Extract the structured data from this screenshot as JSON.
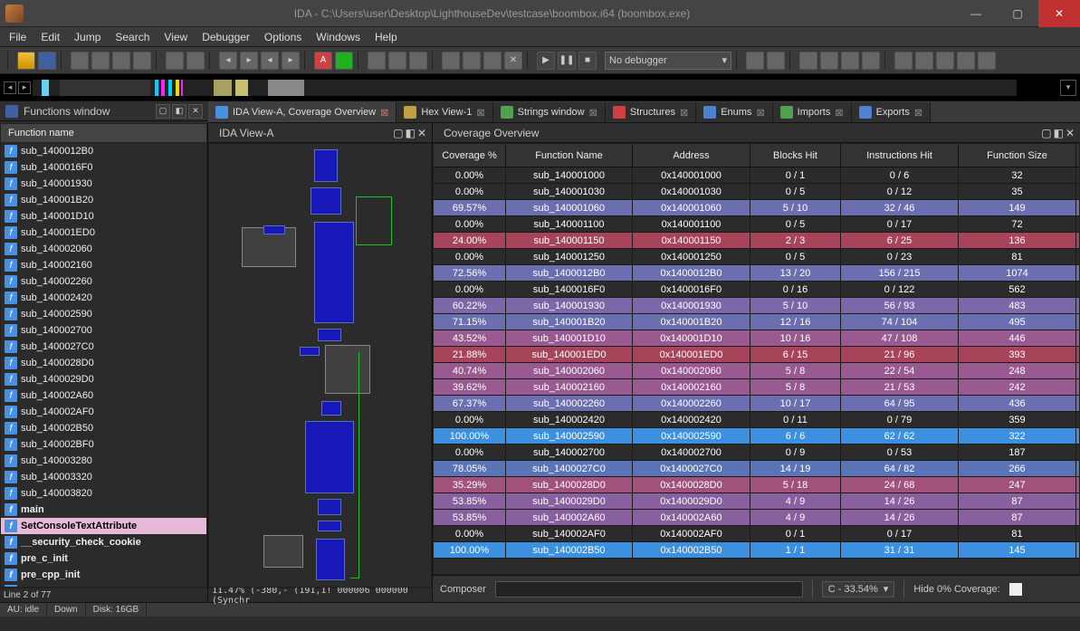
{
  "title": "IDA - C:\\Users\\user\\Desktop\\LighthouseDev\\testcase\\boombox.i64 (boombox.exe)",
  "menu": [
    "File",
    "Edit",
    "Jump",
    "Search",
    "View",
    "Debugger",
    "Options",
    "Windows",
    "Help"
  ],
  "debugger_combo": "No debugger",
  "functions_window": {
    "title": "Functions window",
    "header": "Function name",
    "status": "Line 2 of 77",
    "items": [
      {
        "name": "sub_1400012B0"
      },
      {
        "name": "sub_1400016F0"
      },
      {
        "name": "sub_140001930"
      },
      {
        "name": "sub_140001B20"
      },
      {
        "name": "sub_140001D10"
      },
      {
        "name": "sub_140001ED0"
      },
      {
        "name": "sub_140002060"
      },
      {
        "name": "sub_140002160"
      },
      {
        "name": "sub_140002260"
      },
      {
        "name": "sub_140002420"
      },
      {
        "name": "sub_140002590"
      },
      {
        "name": "sub_140002700"
      },
      {
        "name": "sub_1400027C0"
      },
      {
        "name": "sub_1400028D0"
      },
      {
        "name": "sub_1400029D0"
      },
      {
        "name": "sub_140002A60"
      },
      {
        "name": "sub_140002AF0"
      },
      {
        "name": "sub_140002B50"
      },
      {
        "name": "sub_140002BF0"
      },
      {
        "name": "sub_140003280"
      },
      {
        "name": "sub_140003320"
      },
      {
        "name": "sub_140003820"
      },
      {
        "name": "main",
        "bold": true
      },
      {
        "name": "SetConsoleTextAttribute",
        "hl": true,
        "bold": true
      },
      {
        "name": "__security_check_cookie",
        "bold": true
      },
      {
        "name": "pre_c_init",
        "bold": true
      },
      {
        "name": "pre_cpp_init",
        "bold": true
      },
      {
        "name": "NtCurrentTeb",
        "bold": true
      }
    ]
  },
  "main_tabs": [
    {
      "label": "IDA View-A, Coverage Overview",
      "x": "red",
      "icon": "#4a90e2"
    },
    {
      "label": "Hex View-1",
      "x": "gray",
      "icon": "#c0a040"
    },
    {
      "label": "Strings window",
      "x": "gray",
      "icon": "#50a050"
    },
    {
      "label": "Structures",
      "x": "gray",
      "icon": "#d04040"
    },
    {
      "label": "Enums",
      "x": "gray",
      "icon": "#5080d0"
    },
    {
      "label": "Imports",
      "x": "gray",
      "icon": "#50a050"
    },
    {
      "label": "Exports",
      "x": "gray",
      "icon": "#5080d0"
    }
  ],
  "ida_view": {
    "title": "IDA View-A",
    "status": "11.47% (-380,-  (191,1! 000006 000000 (Synchr"
  },
  "coverage": {
    "title": "Coverage Overview",
    "columns": [
      "Coverage %",
      "Function Name",
      "Address",
      "Blocks Hit",
      "Instructions Hit",
      "Function Size"
    ],
    "rows": [
      {
        "pct": "0.00%",
        "fn": "sub_140001000",
        "addr": "0x140001000",
        "bh": "0 / 1",
        "ih": "0 / 6",
        "sz": "32",
        "bg": "#2b2b2b"
      },
      {
        "pct": "0.00%",
        "fn": "sub_140001030",
        "addr": "0x140001030",
        "bh": "0 / 5",
        "ih": "0 / 12",
        "sz": "35",
        "bg": "#2b2b2b"
      },
      {
        "pct": "69.57%",
        "fn": "sub_140001060",
        "addr": "0x140001060",
        "bh": "5 / 10",
        "ih": "32 / 46",
        "sz": "149",
        "bg": "#6b6fb0"
      },
      {
        "pct": "0.00%",
        "fn": "sub_140001100",
        "addr": "0x140001100",
        "bh": "0 / 5",
        "ih": "0 / 17",
        "sz": "72",
        "bg": "#2b2b2b"
      },
      {
        "pct": "24.00%",
        "fn": "sub_140001150",
        "addr": "0x140001150",
        "bh": "2 / 3",
        "ih": "6 / 25",
        "sz": "136",
        "bg": "#a8445a"
      },
      {
        "pct": "0.00%",
        "fn": "sub_140001250",
        "addr": "0x140001250",
        "bh": "0 / 5",
        "ih": "0 / 23",
        "sz": "81",
        "bg": "#2b2b2b"
      },
      {
        "pct": "72.56%",
        "fn": "sub_1400012B0",
        "addr": "0x1400012B0",
        "bh": "13 / 20",
        "ih": "156 / 215",
        "sz": "1074",
        "bg": "#6b6fb0"
      },
      {
        "pct": "0.00%",
        "fn": "sub_1400016F0",
        "addr": "0x1400016F0",
        "bh": "0 / 16",
        "ih": "0 / 122",
        "sz": "562",
        "bg": "#2b2b2b"
      },
      {
        "pct": "60.22%",
        "fn": "sub_140001930",
        "addr": "0x140001930",
        "bh": "5 / 10",
        "ih": "56 / 93",
        "sz": "483",
        "bg": "#7a68a8"
      },
      {
        "pct": "71.15%",
        "fn": "sub_140001B20",
        "addr": "0x140001B20",
        "bh": "12 / 16",
        "ih": "74 / 104",
        "sz": "495",
        "bg": "#6b6fb0"
      },
      {
        "pct": "43.52%",
        "fn": "sub_140001D10",
        "addr": "0x140001D10",
        "bh": "10 / 16",
        "ih": "47 / 108",
        "sz": "446",
        "bg": "#985a90"
      },
      {
        "pct": "21.88%",
        "fn": "sub_140001ED0",
        "addr": "0x140001ED0",
        "bh": "6 / 15",
        "ih": "21 / 96",
        "sz": "393",
        "bg": "#a8445a"
      },
      {
        "pct": "40.74%",
        "fn": "sub_140002060",
        "addr": "0x140002060",
        "bh": "5 / 8",
        "ih": "22 / 54",
        "sz": "248",
        "bg": "#985a90"
      },
      {
        "pct": "39.62%",
        "fn": "sub_140002160",
        "addr": "0x140002160",
        "bh": "5 / 8",
        "ih": "21 / 53",
        "sz": "242",
        "bg": "#985a90"
      },
      {
        "pct": "67.37%",
        "fn": "sub_140002260",
        "addr": "0x140002260",
        "bh": "10 / 17",
        "ih": "64 / 95",
        "sz": "436",
        "bg": "#6b6fb0"
      },
      {
        "pct": "0.00%",
        "fn": "sub_140002420",
        "addr": "0x140002420",
        "bh": "0 / 11",
        "ih": "0 / 79",
        "sz": "359",
        "bg": "#2b2b2b"
      },
      {
        "pct": "100.00%",
        "fn": "sub_140002590",
        "addr": "0x140002590",
        "bh": "6 / 6",
        "ih": "62 / 62",
        "sz": "322",
        "bg": "#3d8fe0"
      },
      {
        "pct": "0.00%",
        "fn": "sub_140002700",
        "addr": "0x140002700",
        "bh": "0 / 9",
        "ih": "0 / 53",
        "sz": "187",
        "bg": "#2b2b2b"
      },
      {
        "pct": "78.05%",
        "fn": "sub_1400027C0",
        "addr": "0x1400027C0",
        "bh": "14 / 19",
        "ih": "64 / 82",
        "sz": "266",
        "bg": "#5a74b8"
      },
      {
        "pct": "35.29%",
        "fn": "sub_1400028D0",
        "addr": "0x1400028D0",
        "bh": "5 / 18",
        "ih": "24 / 68",
        "sz": "247",
        "bg": "#a0527a"
      },
      {
        "pct": "53.85%",
        "fn": "sub_1400029D0",
        "addr": "0x1400029D0",
        "bh": "4 / 9",
        "ih": "14 / 26",
        "sz": "87",
        "bg": "#8860a0"
      },
      {
        "pct": "53.85%",
        "fn": "sub_140002A60",
        "addr": "0x140002A60",
        "bh": "4 / 9",
        "ih": "14 / 26",
        "sz": "87",
        "bg": "#8860a0"
      },
      {
        "pct": "0.00%",
        "fn": "sub_140002AF0",
        "addr": "0x140002AF0",
        "bh": "0 / 1",
        "ih": "0 / 17",
        "sz": "81",
        "bg": "#2b2b2b"
      },
      {
        "pct": "100.00%",
        "fn": "sub_140002B50",
        "addr": "0x140002B50",
        "bh": "1 / 1",
        "ih": "31 / 31",
        "sz": "145",
        "bg": "#3d8fe0"
      }
    ],
    "composer_label": "Composer",
    "combo": "C - 33.54%",
    "hide_label": "Hide 0% Coverage:"
  },
  "status": {
    "au": "AU:  idle",
    "down": "Down",
    "disk": "Disk: 16GB"
  }
}
